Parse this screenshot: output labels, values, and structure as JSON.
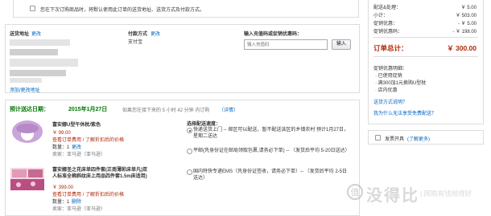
{
  "top_option": {
    "text": "您在下次订购商品时，将默认使用此订单的送货地址、送货方式及付款方式。"
  },
  "address": {
    "title": "送货地址",
    "change": "更改",
    "add_link": "添加/更改地址"
  },
  "payment": {
    "title": "付款方式",
    "change": "更改",
    "value": "支付宝"
  },
  "promo": {
    "title": "输入充值码或促销优惠码：",
    "placeholder": "输入充值码",
    "button": "输入"
  },
  "delivery": {
    "title": "预计送达日期：",
    "date": "2015年1月27日",
    "note": "如果您在接下来的 5 小时 42 分钟 内订购",
    "detail": "（详情）",
    "speed_title": "选择配送速度：",
    "options": [
      {
        "text": "快递送货上门 -- 邮区可以配送，暂不配送该区的乡镇农村 预计1月27日，星期二送达",
        "selected": true
      },
      {
        "text": "平邮(凭身份证在邮局领取包裹,请务必下单) -- （发货后平均 5-20日送达）",
        "selected": false
      },
      {
        "text": "国内特快专递EMS（凭身份证签收，请务必下单）-- （发货后平均 2-5日送达）",
        "selected": false
      }
    ]
  },
  "items": [
    {
      "name": "富安娜U型午休枕/紫色",
      "price": "￥ 99.00",
      "stock": "查看订单费用 / 了解折扣后的价格",
      "qty_label": "数量：1",
      "qty_change": "更改",
      "seller": "卖家：亚马逊（亚马逊）"
    },
    {
      "name": "富安娜圣之花床单四件套(正南薄彩床单凡)双人标准全棉斜纹床上用品四件套1.5m床适用)",
      "price": "￥ 399.00",
      "stock": "查看订单费用 / 了解折扣后的价格",
      "qty_label": "数量：1",
      "qty_change": "删除",
      "seller": "卖家：亚马逊（亚马逊）"
    }
  ],
  "summary": {
    "rows": [
      {
        "label": "配送&处理：",
        "value": "￥ 5.00"
      },
      {
        "label": "小计：",
        "value": "￥ 503.00"
      },
      {
        "label": "促销优惠：",
        "value": "- ￥ 5.00"
      },
      {
        "label": "促销优惠码：",
        "value": "- ￥ 198.00"
      }
    ],
    "total_label": "订单总计：",
    "total_value": "￥ 300.00",
    "promo_title": "促销优惠明细：",
    "promo_lines": [
      "· 已使用促销",
      "· 满300加1元换购U型枕",
      "· 店内优惠"
    ],
    "link1": "送货方式说明？",
    "link2": "我为什么无法享受免费配送？",
    "invoice_label": "发票开具",
    "invoice_link": "(了解更多)"
  },
  "watermark": {
    "text": "没得比",
    "sub": "| 网购有钱就得好"
  },
  "colors": {
    "accent_red": "#b12704",
    "link_blue": "#0066c0",
    "delivery_green": "#007600"
  }
}
